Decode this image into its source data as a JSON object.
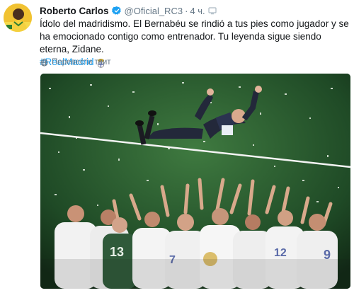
{
  "tweet": {
    "author_name": "Roberto Carlos",
    "handle": "@Oficial_RC3",
    "separator": "·",
    "time": "4 ч.",
    "verified_icon": "verified-badge-icon",
    "text": "Ídolo del madridismo. El Bernabéu se rindió a tus pies como jugador y se ha emocionado contigo como entrenador. Tu leyenda sigue siendo eterna, Zidane.",
    "hashtag": "#RealMadrid",
    "hashtag_icon": "real-madrid-crest-icon",
    "translate_label": "Перевести твит",
    "translate_icon": "globe-icon",
    "photo_icon": "photo-celebration-image"
  },
  "colors": {
    "link": "#1da1f2",
    "secondary_text": "#657786",
    "primary_text": "#14171a",
    "verified": "#1da1f2",
    "pitch": "#1f4a26"
  }
}
